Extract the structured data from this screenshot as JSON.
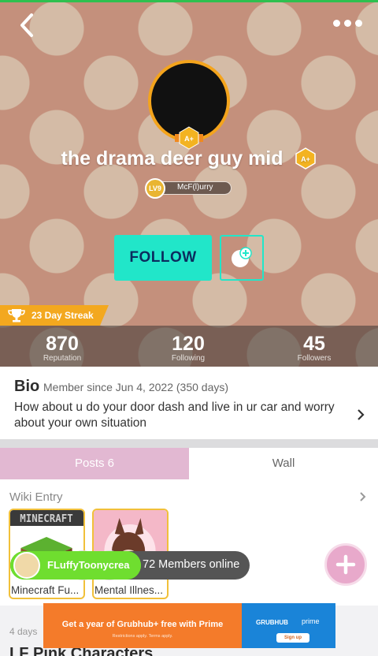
{
  "profile": {
    "username": "the drama deer guy mid",
    "level": "LV9",
    "title_tag": "McF(l)urry",
    "follow_label": "FOLLOW",
    "streak": "23 Day Streak"
  },
  "stats": [
    {
      "value": "870",
      "label": "Reputation"
    },
    {
      "value": "120",
      "label": "Following"
    },
    {
      "value": "45",
      "label": "Followers"
    }
  ],
  "bio": {
    "title": "Bio",
    "since": "Member since Jun 4, 2022 (350 days)",
    "text": "How about u do your door dash and live in ur car and worry about your own situation"
  },
  "tabs": {
    "posts": "Posts 6",
    "wall": "Wall"
  },
  "wiki": {
    "title": "Wiki Entry",
    "cards": [
      {
        "caption": "Minecraft Fu...",
        "thumb_text": "MINECRAFT"
      },
      {
        "caption": "Mental Illnes..."
      }
    ]
  },
  "online": {
    "name": "FLuffyToonycrea",
    "count": "72 Members online"
  },
  "feed": {
    "time": "4 days",
    "title": "LF Pink Characters"
  },
  "ad": {
    "headline": "Get a year of Grubhub+ free with Prime",
    "fineprint": "Restrictions apply. Terms apply.",
    "brand1": "GRUBHUB",
    "brand2": "prime",
    "cta": "Sign up"
  },
  "colors": {
    "header_bg": "#c4907c",
    "accent": "#21e6c9",
    "streak": "#f3a81f",
    "tab_active": "#e2b8d2"
  }
}
